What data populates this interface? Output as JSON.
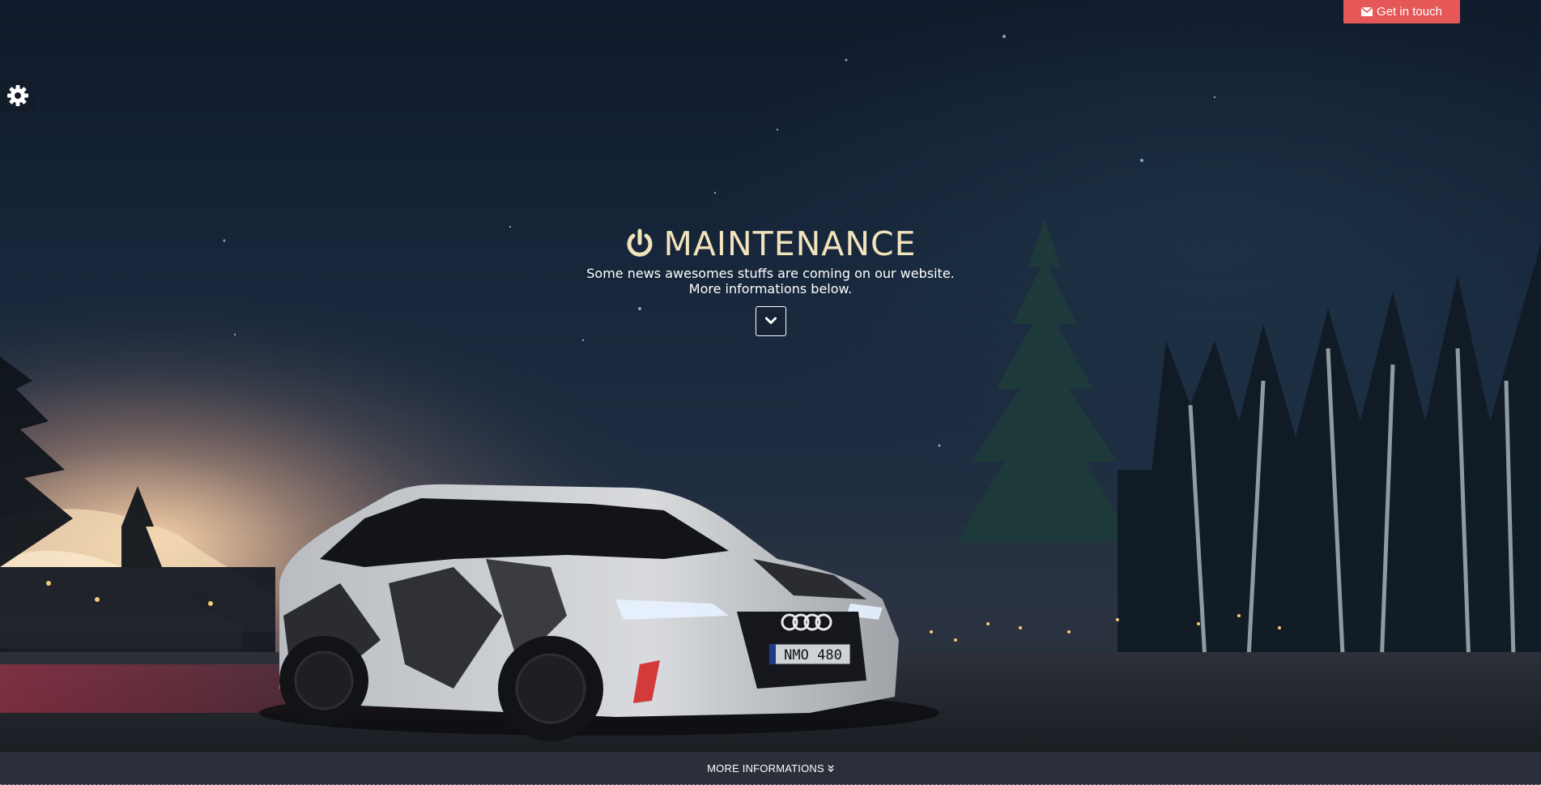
{
  "header": {
    "contact_button": {
      "label": "Get in touch",
      "icon": "envelope-icon",
      "color": "#e65757"
    }
  },
  "settings": {
    "icon": "gear-icon"
  },
  "hero": {
    "title": "MAINTENANCE",
    "title_icon": "power-icon",
    "title_color": "#f2e3bd",
    "subtitle_line1": "Some news awesomes stuffs are coming on our website.",
    "subtitle_line2": "More informations below.",
    "scroll_down_icon": "chevron-down-icon",
    "background_image": "night scene with camouflaged Audi station wagon, pine trees and lit hillside",
    "license_plate": "NMO 480"
  },
  "footer": {
    "more_label": "MORE INFORMATIONS",
    "more_icon": "double-chevron-down-icon",
    "background_color": "#2c2f3a"
  }
}
